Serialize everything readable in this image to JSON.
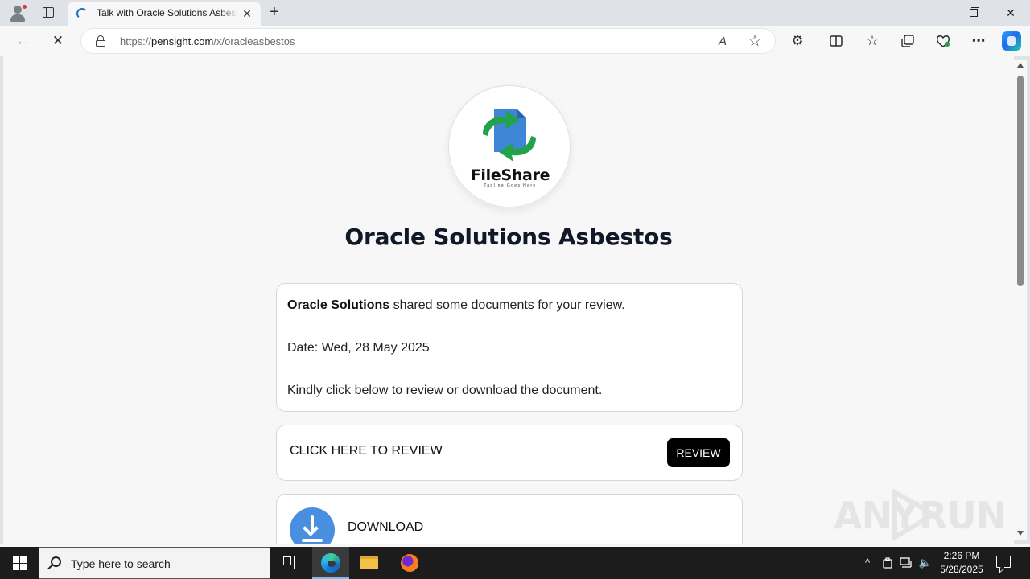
{
  "browser": {
    "tab": {
      "title": "Talk with Oracle Solutions Asbestos",
      "close_glyph": "✕"
    },
    "new_tab_glyph": "+",
    "window_controls": {
      "minimize_glyph": "—",
      "close_glyph": "✕"
    },
    "address_bar": {
      "url_scheme": "https://",
      "url_host": "pensight.com",
      "url_path": "/x/oracleasbestos"
    },
    "toolbar_icons": [
      "back-icon",
      "stop-loading-icon",
      "read-aloud-icon",
      "favorite-star-icon",
      "extensions-icon",
      "split-screen-icon",
      "favorites-icon",
      "collections-icon",
      "browser-essentials-icon",
      "more-menu-icon",
      "copilot-icon"
    ],
    "glyphs": {
      "back": "←",
      "stop": "✕",
      "read_aloud": "A",
      "favorite": "☆",
      "extensions": "⚙",
      "favorites": "☆",
      "more": "⋯"
    }
  },
  "page": {
    "logo": {
      "name": "FileShare",
      "tagline": "Tagline Goes Here"
    },
    "title": "Oracle Solutions Asbestos",
    "info_card": {
      "sender": "Oracle Solutions",
      "shared_text": " shared some documents for your review.",
      "date_text": "Date: Wed, 28 May 2025",
      "instruction": "Kindly click below to review or download the document."
    },
    "review_card": {
      "text": "CLICK HERE TO REVIEW",
      "button_label": "REVIEW"
    },
    "download_card": {
      "text": "DOWNLOAD"
    }
  },
  "watermark": {
    "left": "ANY",
    "right": "RUN"
  },
  "taskbar": {
    "search_placeholder": "Type here to search",
    "tray": {
      "chevron": "^",
      "volume": "🔈"
    },
    "clock": {
      "time": "2:26 PM",
      "date": "5/28/2025"
    }
  },
  "colors": {
    "accent_blue": "#4a8fdf",
    "logo_green": "#22a34a",
    "button_black": "#000000",
    "title_color": "#111827"
  }
}
